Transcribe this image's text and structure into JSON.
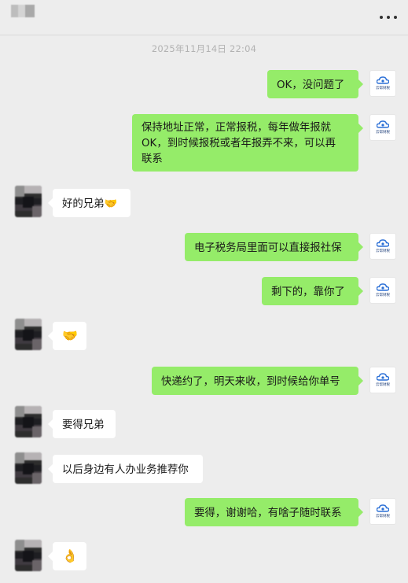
{
  "header": {
    "more_icon": "more-dots-icon"
  },
  "timestamp": "2025年11月14日 22:04",
  "avatar_logo_text": "云帮财税",
  "colors": {
    "outgoing_bubble": "#95ec69",
    "incoming_bubble": "#ffffff",
    "background": "#ededed"
  },
  "messages": [
    {
      "side": "out",
      "text": "OK，没问题了"
    },
    {
      "side": "out",
      "text": "保持地址正常，正常报税，每年做年报就\nOK，到时候报税或者年报弄不来，可以再\n联系"
    },
    {
      "side": "in",
      "text": "好的兄弟🤝"
    },
    {
      "side": "out",
      "text": "电子税务局里面可以直接报社保"
    },
    {
      "side": "out",
      "text": "剩下的，靠你了"
    },
    {
      "side": "in",
      "text": "🤝"
    },
    {
      "side": "out",
      "text": "快递约了，明天来收，到时候给你单号"
    },
    {
      "side": "in",
      "text": "要得兄弟"
    },
    {
      "side": "in",
      "text": "以后身边有人办业务推荐你"
    },
    {
      "side": "out",
      "text": "要得，谢谢哈，有啥子随时联系"
    },
    {
      "side": "in",
      "text": "👌"
    }
  ]
}
